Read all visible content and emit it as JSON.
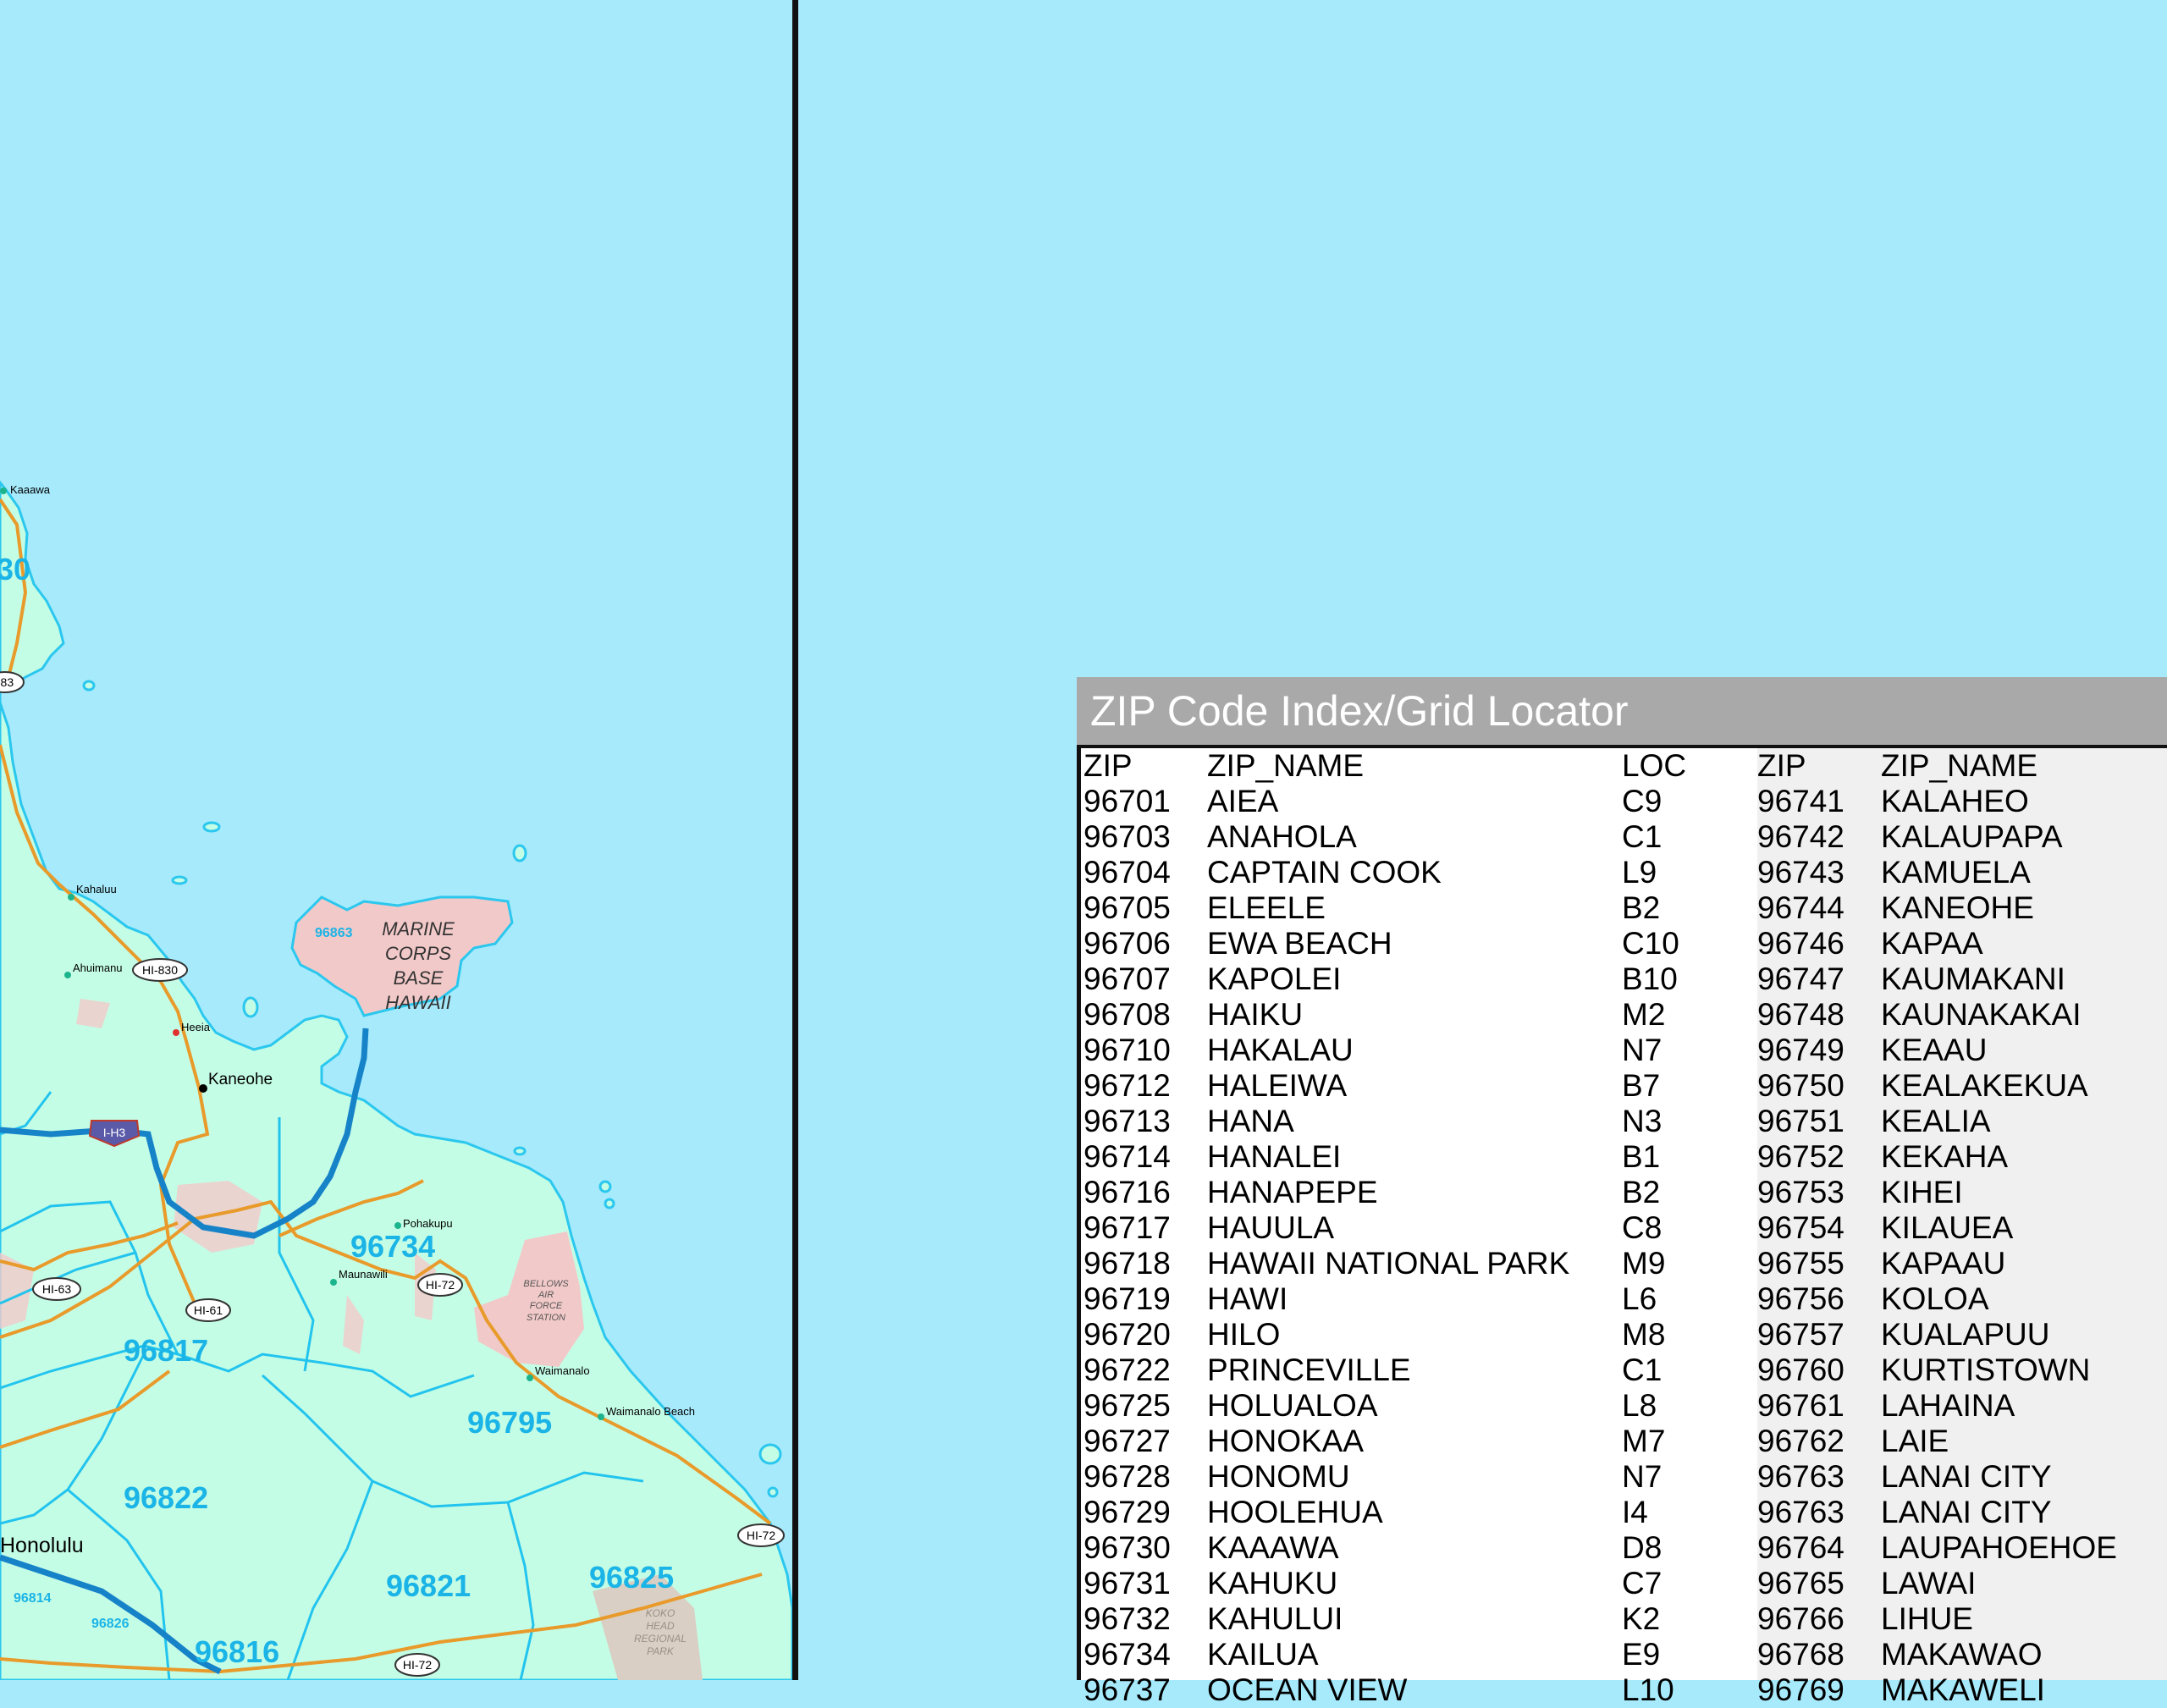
{
  "index": {
    "title": "ZIP Code Index/Grid Locator",
    "columns": [
      "ZIP",
      "ZIP_NAME",
      "LOC",
      "ZIP",
      "ZIP_NAME"
    ],
    "rows": [
      [
        "96701",
        "AIEA",
        "C9",
        "96741",
        "KALAHEO"
      ],
      [
        "96703",
        "ANAHOLA",
        "C1",
        "96742",
        "KALAUPAPA"
      ],
      [
        "96704",
        "CAPTAIN COOK",
        "L9",
        "96743",
        "KAMUELA"
      ],
      [
        "96705",
        "ELEELE",
        "B2",
        "96744",
        "KANEOHE"
      ],
      [
        "96706",
        "EWA BEACH",
        "C10",
        "96746",
        "KAPAA"
      ],
      [
        "96707",
        "KAPOLEI",
        "B10",
        "96747",
        "KAUMAKANI"
      ],
      [
        "96708",
        "HAIKU",
        "M2",
        "96748",
        "KAUNAKAKAI"
      ],
      [
        "96710",
        "HAKALAU",
        "N7",
        "96749",
        "KEAAU"
      ],
      [
        "96712",
        "HALEIWA",
        "B7",
        "96750",
        "KEALAKEKUA"
      ],
      [
        "96713",
        "HANA",
        "N3",
        "96751",
        "KEALIA"
      ],
      [
        "96714",
        "HANALEI",
        "B1",
        "96752",
        "KEKAHA"
      ],
      [
        "96716",
        "HANAPEPE",
        "B2",
        "96753",
        "KIHEI"
      ],
      [
        "96717",
        "HAUULA",
        "C8",
        "96754",
        "KILAUEA"
      ],
      [
        "96718",
        "HAWAII NATIONAL PARK",
        "M9",
        "96755",
        "KAPAAU"
      ],
      [
        "96719",
        "HAWI",
        "L6",
        "96756",
        "KOLOA"
      ],
      [
        "96720",
        "HILO",
        "M8",
        "96757",
        "KUALAPUU"
      ],
      [
        "96722",
        "PRINCEVILLE",
        "C1",
        "96760",
        "KURTISTOWN"
      ],
      [
        "96725",
        "HOLUALOA",
        "L8",
        "96761",
        "LAHAINA"
      ],
      [
        "96727",
        "HONOKAA",
        "M7",
        "96762",
        "LAIE"
      ],
      [
        "96728",
        "HONOMU",
        "N7",
        "96763",
        "LANAI CITY"
      ],
      [
        "96729",
        "HOOLEHUA",
        "I4",
        "96763",
        "LANAI CITY"
      ],
      [
        "96730",
        "KAAAWA",
        "D8",
        "96764",
        "LAUPAHOEHOE"
      ],
      [
        "96731",
        "KAHUKU",
        "C7",
        "96765",
        "LAWAI"
      ],
      [
        "96732",
        "KAHULUI",
        "K2",
        "96766",
        "LIHUE"
      ],
      [
        "96734",
        "KAILUA",
        "E9",
        "96768",
        "MAKAWAO"
      ],
      [
        "96737",
        "OCEAN VIEW",
        "L10",
        "96769",
        "MAKAWELI"
      ]
    ]
  },
  "map": {
    "zip_labels": [
      "30",
      "96863",
      "96734",
      "96817",
      "96795",
      "96822",
      "96821",
      "96825",
      "96814",
      "96826",
      "96816"
    ],
    "place_labels": [
      "Kaaawa",
      "Kahaluu",
      "Ahuimanu",
      "Heeia",
      "Kaneohe",
      "Pohakupu",
      "Maunawili",
      "Waimanalo",
      "Waimanalo Beach",
      "Honolulu"
    ],
    "area_labels": {
      "marine_base": [
        "MARINE",
        "CORPS",
        "BASE",
        "HAWAII"
      ],
      "bellows": [
        "BELLOWS",
        "AIR",
        "FORCE",
        "STATION"
      ],
      "koko_head": [
        "KOKO",
        "HEAD",
        "REGIONAL",
        "PARK"
      ]
    },
    "route_shields": [
      "-83",
      "HI-830",
      "I-H3",
      "HI-63",
      "HI-61",
      "HI-72",
      "HI-72",
      "HI-72"
    ],
    "colors": {
      "water": "#a6eafc",
      "land": "#c4fde6",
      "military": "#f2c9c9",
      "zip_text": "#1bb4e6",
      "road": "#e89a2a",
      "highway": "#1683c8",
      "boundary": "#22c4ee"
    }
  }
}
